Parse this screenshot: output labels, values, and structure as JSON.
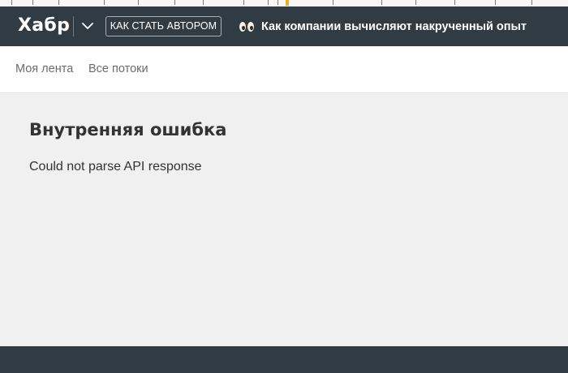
{
  "header": {
    "logo": "Хабр",
    "author_button": "КАК СТАТЬ АВТОРОМ",
    "promo_icon": "eyes-icon",
    "promo_text": "Как компании вычисляют накрученный опыт",
    "menu_icon": "chevron-down-icon"
  },
  "tabs": [
    {
      "label": "Моя лента"
    },
    {
      "label": "Все потоки"
    }
  ],
  "error": {
    "title": "Внутренняя ошибка",
    "message": "Could not parse API response"
  },
  "colors": {
    "header_bg": "#303b44",
    "page_bg": "#f0f0f0",
    "tab_text": "#6b6b6b",
    "title_text": "#333333"
  }
}
